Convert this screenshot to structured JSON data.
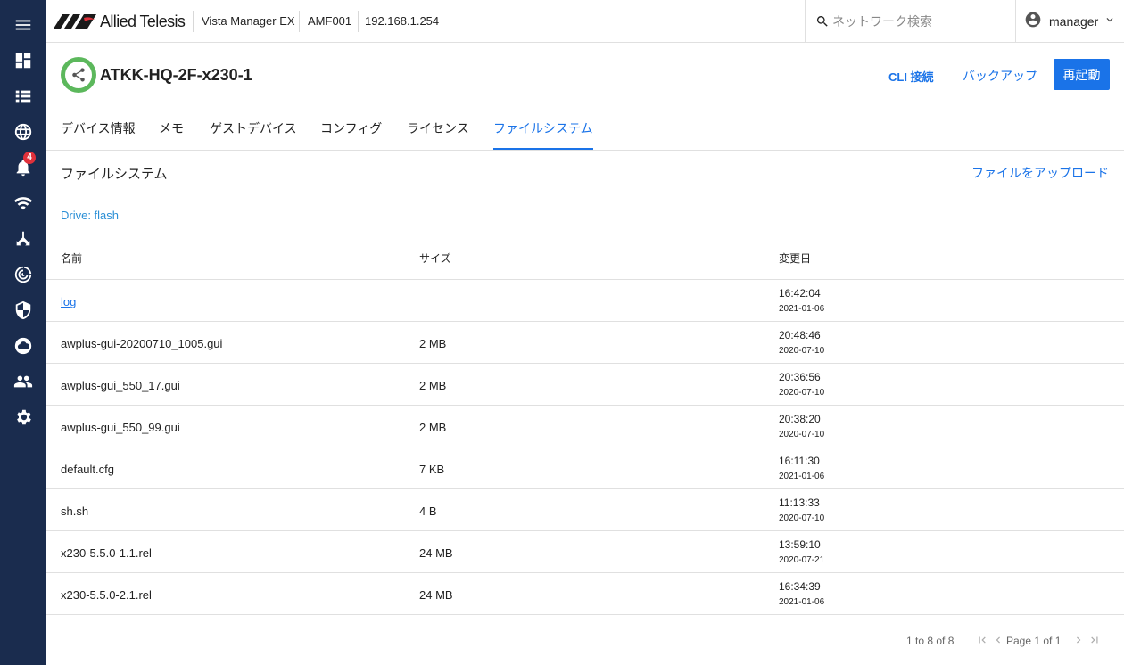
{
  "header": {
    "brand": "Allied Telesis",
    "product": "Vista Manager EX",
    "amf": "AMF001",
    "ip": "192.168.1.254",
    "search_placeholder": "ネットワーク検索",
    "user": "manager"
  },
  "sidebar": {
    "items": [
      {
        "name": "menu-icon"
      },
      {
        "name": "dashboard-icon"
      },
      {
        "name": "list-icon"
      },
      {
        "name": "globe-icon"
      },
      {
        "name": "alarm-icon",
        "badge": "4"
      },
      {
        "name": "wifi-icon"
      },
      {
        "name": "topology-icon"
      },
      {
        "name": "radar-icon"
      },
      {
        "name": "shield-icon"
      },
      {
        "name": "cloud-icon"
      },
      {
        "name": "users-icon"
      },
      {
        "name": "gear-icon"
      }
    ]
  },
  "device": {
    "name": "ATKK-HQ-2F-x230-1",
    "cli_label": "CLI 接続",
    "backup_label": "バックアップ",
    "reboot_label": "再起動"
  },
  "tabs": [
    {
      "label": "デバイス情報"
    },
    {
      "label": "メモ"
    },
    {
      "label": "ゲストデバイス"
    },
    {
      "label": "コンフィグ"
    },
    {
      "label": "ライセンス"
    },
    {
      "label": "ファイルシステム",
      "active": true
    }
  ],
  "filesystem": {
    "title": "ファイルシステム",
    "upload_label": "ファイルをアップロード",
    "drive_label": "Drive: flash",
    "columns": {
      "name": "名前",
      "size": "サイズ",
      "modified": "変更日"
    },
    "rows": [
      {
        "name": "log",
        "size": "",
        "time": "16:42:04",
        "date": "2021-01-06",
        "link": true
      },
      {
        "name": "awplus-gui-20200710_1005.gui",
        "size": "2 MB",
        "time": "20:48:46",
        "date": "2020-07-10"
      },
      {
        "name": "awplus-gui_550_17.gui",
        "size": "2 MB",
        "time": "20:36:56",
        "date": "2020-07-10"
      },
      {
        "name": "awplus-gui_550_99.gui",
        "size": "2 MB",
        "time": "20:38:20",
        "date": "2020-07-10"
      },
      {
        "name": "default.cfg",
        "size": "7 KB",
        "time": "16:11:30",
        "date": "2021-01-06"
      },
      {
        "name": "sh.sh",
        "size": "4 B",
        "time": "11:13:33",
        "date": "2020-07-10"
      },
      {
        "name": "x230-5.5.0-1.1.rel",
        "size": "24 MB",
        "time": "13:59:10",
        "date": "2020-07-21"
      },
      {
        "name": "x230-5.5.0-2.1.rel",
        "size": "24 MB",
        "time": "16:34:39",
        "date": "2021-01-06"
      }
    ]
  },
  "pager": {
    "count": "1 to 8 of 8",
    "page": "Page 1 of 1"
  }
}
